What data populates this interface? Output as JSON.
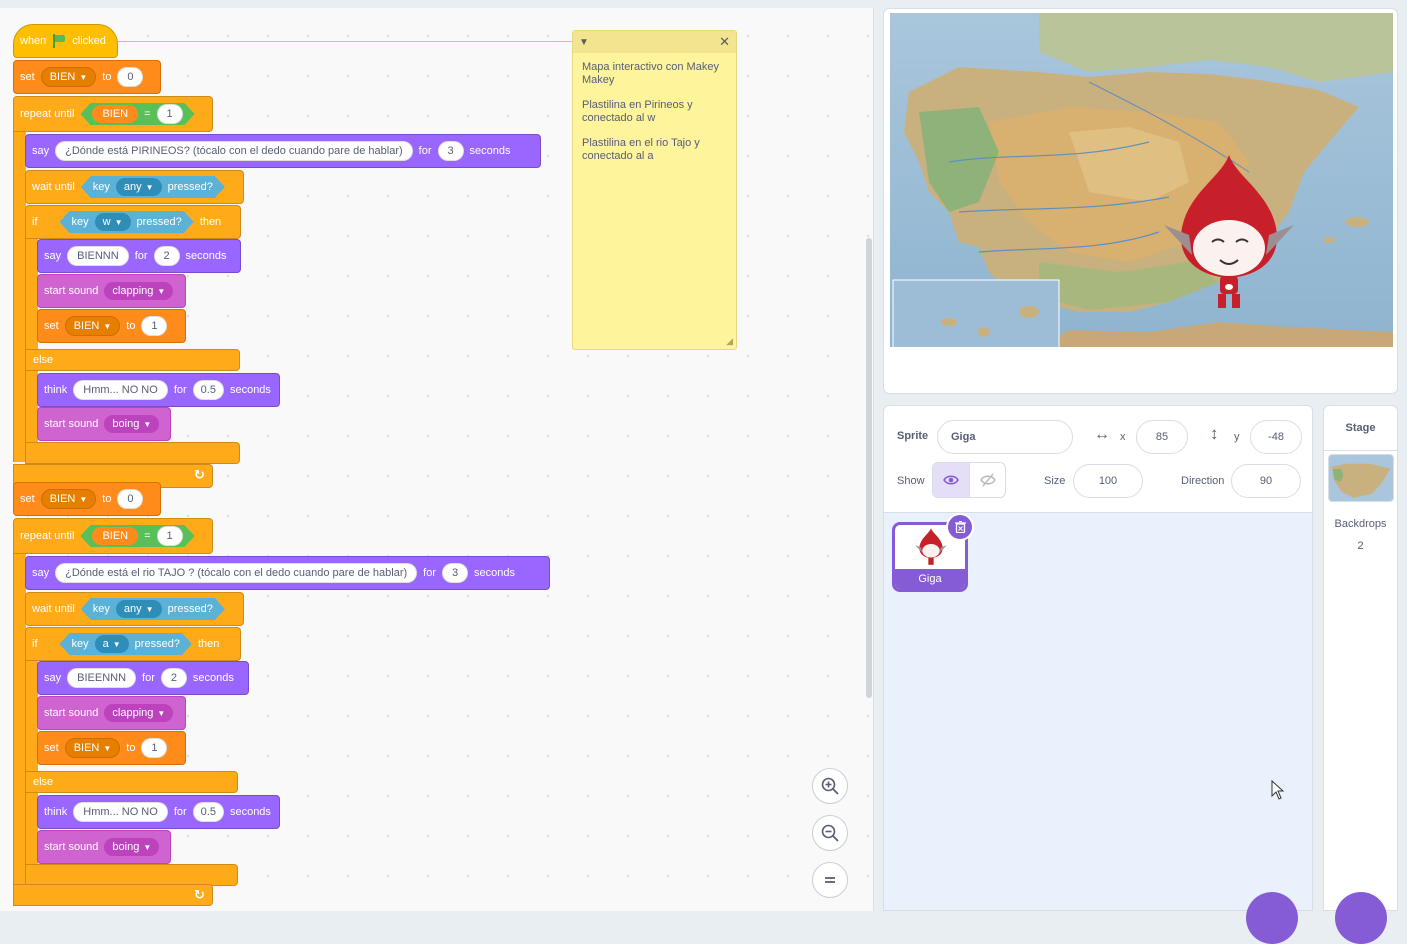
{
  "script1": {
    "hat": {
      "when": "when",
      "clicked": "clicked"
    },
    "set_a": {
      "set": "set",
      "var": "BIEN",
      "to": "to",
      "value": "0"
    },
    "repeat": {
      "label": "repeat until",
      "var": "BIEN",
      "op": "=",
      "value": "1"
    },
    "say_q": {
      "say": "say",
      "text": "¿Dónde está PIRINEOS? (tócalo con el dedo cuando pare de hablar)",
      "for": "for",
      "secs": "3",
      "seconds": "seconds"
    },
    "wait": {
      "label": "wait until",
      "key": "key",
      "keyval": "any",
      "pressed": "pressed?"
    },
    "if": {
      "if": "if",
      "key": "key",
      "keyval": "w",
      "pressed": "pressed?",
      "then": "then"
    },
    "say_ok": {
      "say": "say",
      "text": "BIENNN",
      "for": "for",
      "secs": "2",
      "seconds": "seconds"
    },
    "snd_ok": {
      "label": "start sound",
      "sound": "clapping"
    },
    "set_b": {
      "set": "set",
      "var": "BIEN",
      "to": "to",
      "value": "1"
    },
    "else": "else",
    "think": {
      "think": "think",
      "text": "Hmm... NO NO",
      "for": "for",
      "secs": "0.5",
      "seconds": "seconds"
    },
    "snd_bad": {
      "label": "start sound",
      "sound": "boing"
    }
  },
  "script2": {
    "set_a": {
      "set": "set",
      "var": "BIEN",
      "to": "to",
      "value": "0"
    },
    "repeat": {
      "label": "repeat until",
      "var": "BIEN",
      "op": "=",
      "value": "1"
    },
    "say_q": {
      "say": "say",
      "text": "¿Dónde está el rio TAJO ?  (tócalo con el dedo cuando pare de hablar)",
      "for": "for",
      "secs": "3",
      "seconds": "seconds"
    },
    "wait": {
      "label": "wait until",
      "key": "key",
      "keyval": "any",
      "pressed": "pressed?"
    },
    "if": {
      "if": "if",
      "key": "key",
      "keyval": "a",
      "pressed": "pressed?",
      "then": "then"
    },
    "say_ok": {
      "say": "say",
      "text": "BIEENNN",
      "for": "for",
      "secs": "2",
      "seconds": "seconds"
    },
    "snd_ok": {
      "label": "start sound",
      "sound": "clapping"
    },
    "set_b": {
      "set": "set",
      "var": "BIEN",
      "to": "to",
      "value": "1"
    },
    "else": "else",
    "think": {
      "think": "think",
      "text": "Hmm... NO NO",
      "for": "for",
      "secs": "0.5",
      "seconds": "seconds"
    },
    "snd_bad": {
      "label": "start sound",
      "sound": "boing"
    }
  },
  "comment": {
    "lines": [
      "Mapa interactivo con Makey Makey",
      "Plastilina en Pirineos y conectado al w",
      "Plastilina en el rio Tajo y conectado al a"
    ]
  },
  "sprite_info": {
    "sprite_label": "Sprite",
    "sprite_name": "Giga",
    "x_label": "x",
    "x": "85",
    "y_label": "y",
    "y": "-48",
    "show_label": "Show",
    "size_label": "Size",
    "size": "100",
    "direction_label": "Direction",
    "direction": "90"
  },
  "sprites": [
    {
      "name": "Giga"
    }
  ],
  "stage_pane": {
    "title": "Stage",
    "backdrops_label": "Backdrops",
    "backdrops_count": "2"
  },
  "colors": {
    "control": "#ffab19",
    "variables": "#ff8c1a",
    "looks": "#9966ff",
    "sound": "#cf63cf",
    "sensing": "#5cb1d6",
    "operators": "#59c059",
    "events": "#ffbf00",
    "accent": "#855cd6"
  },
  "icons": {
    "green_flag": "green-flag-icon",
    "zoom_in": "zoom-in-icon",
    "zoom_out": "zoom-out-icon",
    "zoom_reset": "zoom-reset-icon",
    "eye": "eye-icon",
    "eye_off": "eye-off-icon",
    "trash": "trash-icon"
  }
}
